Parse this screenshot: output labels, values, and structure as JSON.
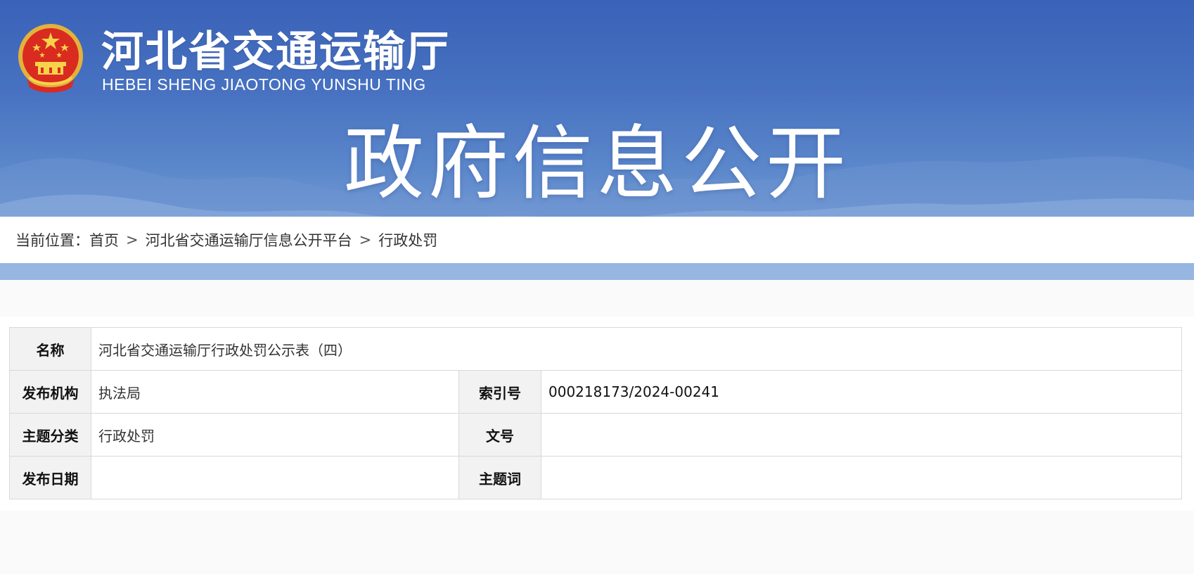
{
  "header": {
    "site_name_cn": "河北省交通运输厅",
    "site_name_en": "HEBEI SHENG JIAOTONG YUNSHU TING",
    "banner_title": "政府信息公开",
    "emblem_icon": "national-emblem-icon",
    "colors": {
      "banner_top": "#3a62b8",
      "banner_bottom": "#86a9db"
    }
  },
  "breadcrumb": {
    "prefix": "当前位置：",
    "items": [
      "首页",
      "河北省交通运输厅信息公开平台",
      "行政处罚"
    ],
    "separator": ">"
  },
  "info_table": {
    "name_label": "名称",
    "name_value": "河北省交通运输厅行政处罚公示表（四）",
    "publisher_label": "发布机构",
    "publisher_value": "执法局",
    "index_label": "索引号",
    "index_value": "000218173/2024-00241",
    "category_label": "主题分类",
    "category_value": "行政处罚",
    "doc_no_label": "文号",
    "doc_no_value": "",
    "date_label": "发布日期",
    "date_value": "",
    "keywords_label": "主题词",
    "keywords_value": ""
  }
}
